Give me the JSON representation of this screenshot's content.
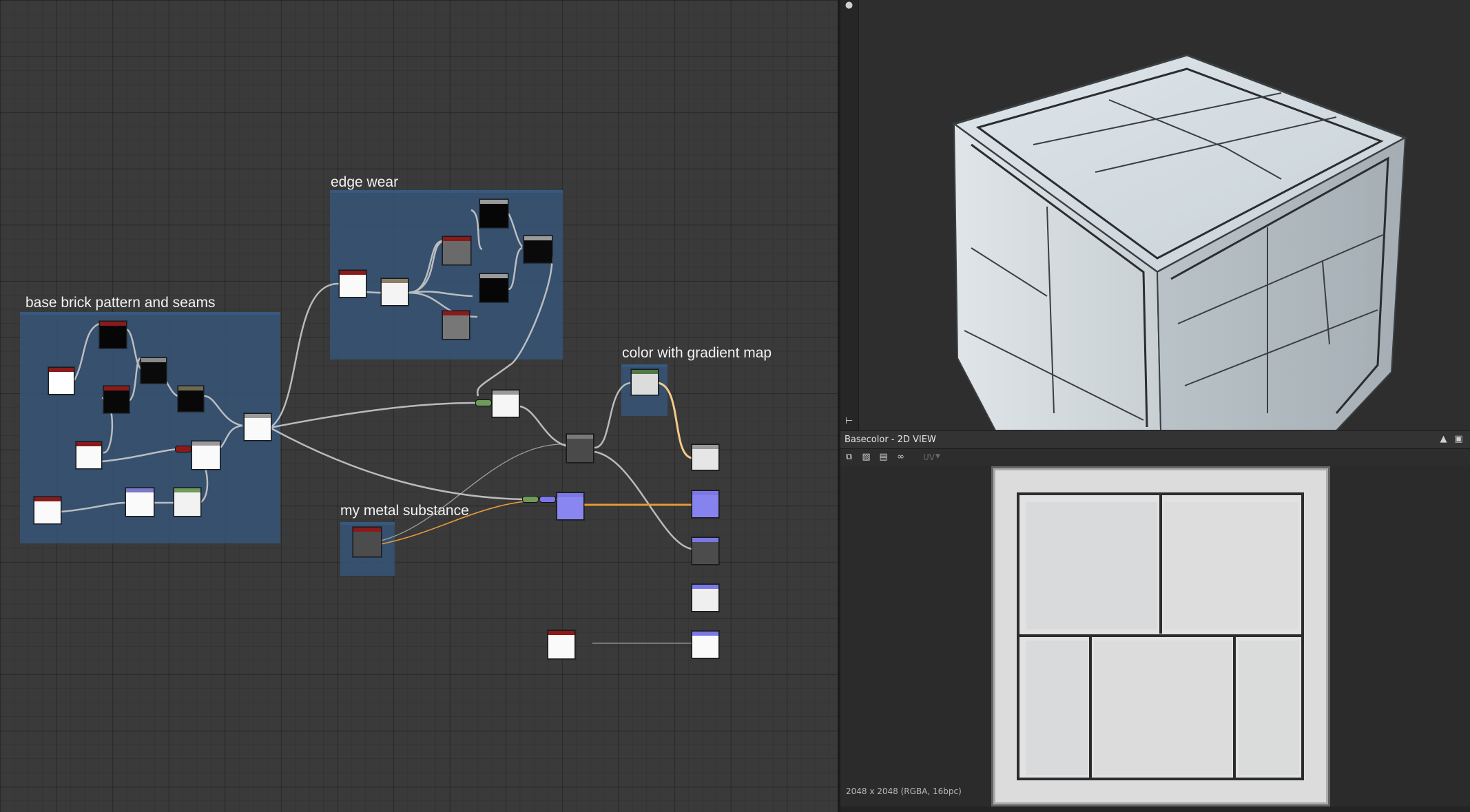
{
  "graph": {
    "frames": [
      {
        "title": "base brick pattern and seams"
      },
      {
        "title": "edge wear"
      },
      {
        "title": "my metal substance"
      },
      {
        "title": "color with gradient map"
      }
    ]
  },
  "preview2d": {
    "title": "Basecolor - 2D VIEW",
    "uv_label": "UV",
    "status": "2048 x 2048 (RGBA, 16bpc)"
  },
  "colors": {
    "frame": "#36567c",
    "node_header_red": "#8b1a1a",
    "node_header_gray": "#8a8a8a",
    "node_header_green": "#4f7a45",
    "output_purple": "#7b78e6",
    "time_green": "#3ddc3d",
    "link_orange": "#e89a3a"
  },
  "icons": [
    "light-icon",
    "scene-tree-icon",
    "pin-icon",
    "maximize-icon",
    "copy-image-icon",
    "save-icon",
    "export-icon",
    "share-icon",
    "chevron-down-icon"
  ]
}
